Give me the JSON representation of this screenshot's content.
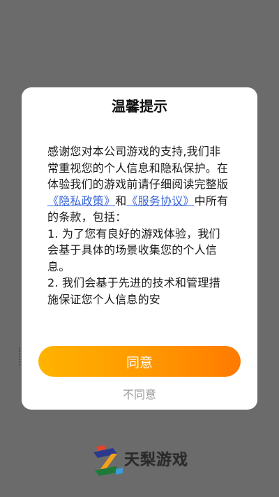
{
  "dialog": {
    "title": "温馨提示",
    "body": {
      "intro": "感谢您对本公司游戏的支持,我们非常重视您的个人信息和隐私保护。在体验我们的游戏前请仔细阅读完整版",
      "privacy_link": "《隐私政策》",
      "and": "和",
      "service_link": "《服务协议》",
      "outro": "中所有的条款，包括：",
      "item1": "1. 为了您有良好的游戏体验，我们会基于具体的场景收集您的个人信息。",
      "item2": "2. 我们会基于先进的技术和管理措施保证您个人信息的安"
    },
    "agree_label": "同意",
    "disagree_label": "不同意"
  },
  "brand": {
    "name": "天梨游戏",
    "logo_icon": "tianli-logo-icon"
  },
  "colors": {
    "overlay": "#6b6b6b",
    "link": "#3a66d8",
    "button_start": "#ffb300",
    "button_end": "#ff7a00",
    "disagree_text": "#9a9a9a"
  }
}
